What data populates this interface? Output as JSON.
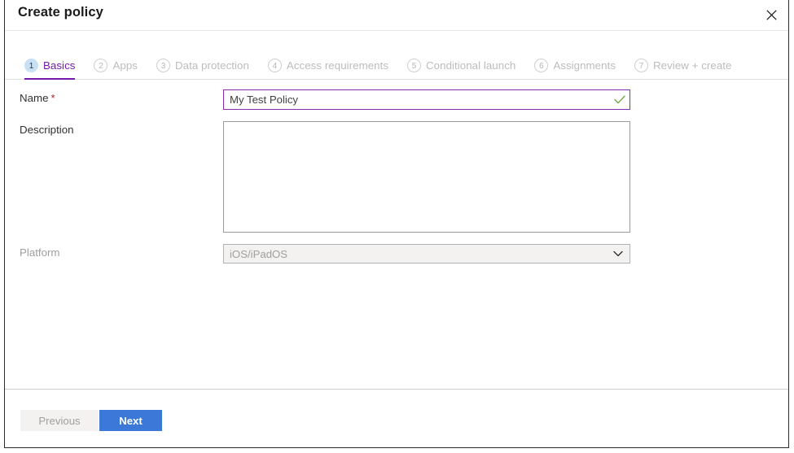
{
  "header": {
    "title": "Create policy",
    "close_icon": "close-icon"
  },
  "tabs": [
    {
      "number": "1",
      "label": "Basics",
      "active": true
    },
    {
      "number": "2",
      "label": "Apps",
      "active": false
    },
    {
      "number": "3",
      "label": "Data protection",
      "active": false
    },
    {
      "number": "4",
      "label": "Access requirements",
      "active": false
    },
    {
      "number": "5",
      "label": "Conditional launch",
      "active": false
    },
    {
      "number": "6",
      "label": "Assignments",
      "active": false
    },
    {
      "number": "7",
      "label": "Review + create",
      "active": false
    }
  ],
  "form": {
    "name": {
      "label": "Name",
      "required_marker": "*",
      "value": "My Test Policy",
      "placeholder": "",
      "valid_icon": "checkmark-icon"
    },
    "description": {
      "label": "Description",
      "value": "",
      "placeholder": ""
    },
    "platform": {
      "label": "Platform",
      "value": "iOS/iPadOS",
      "disabled": true,
      "chevron_icon": "chevron-down-icon",
      "options": [
        "iOS/iPadOS"
      ]
    }
  },
  "footer": {
    "previous_label": "Previous",
    "next_label": "Next"
  },
  "colors": {
    "accent_purple": "#7719aa",
    "name_border_purple": "#8b2bb0",
    "primary_blue": "#3b78d8",
    "valid_green": "#6aa13a",
    "required_red": "#a4262c",
    "active_badge_blue": "#c7e0f4",
    "disabled_grey": "#a19f9d"
  }
}
